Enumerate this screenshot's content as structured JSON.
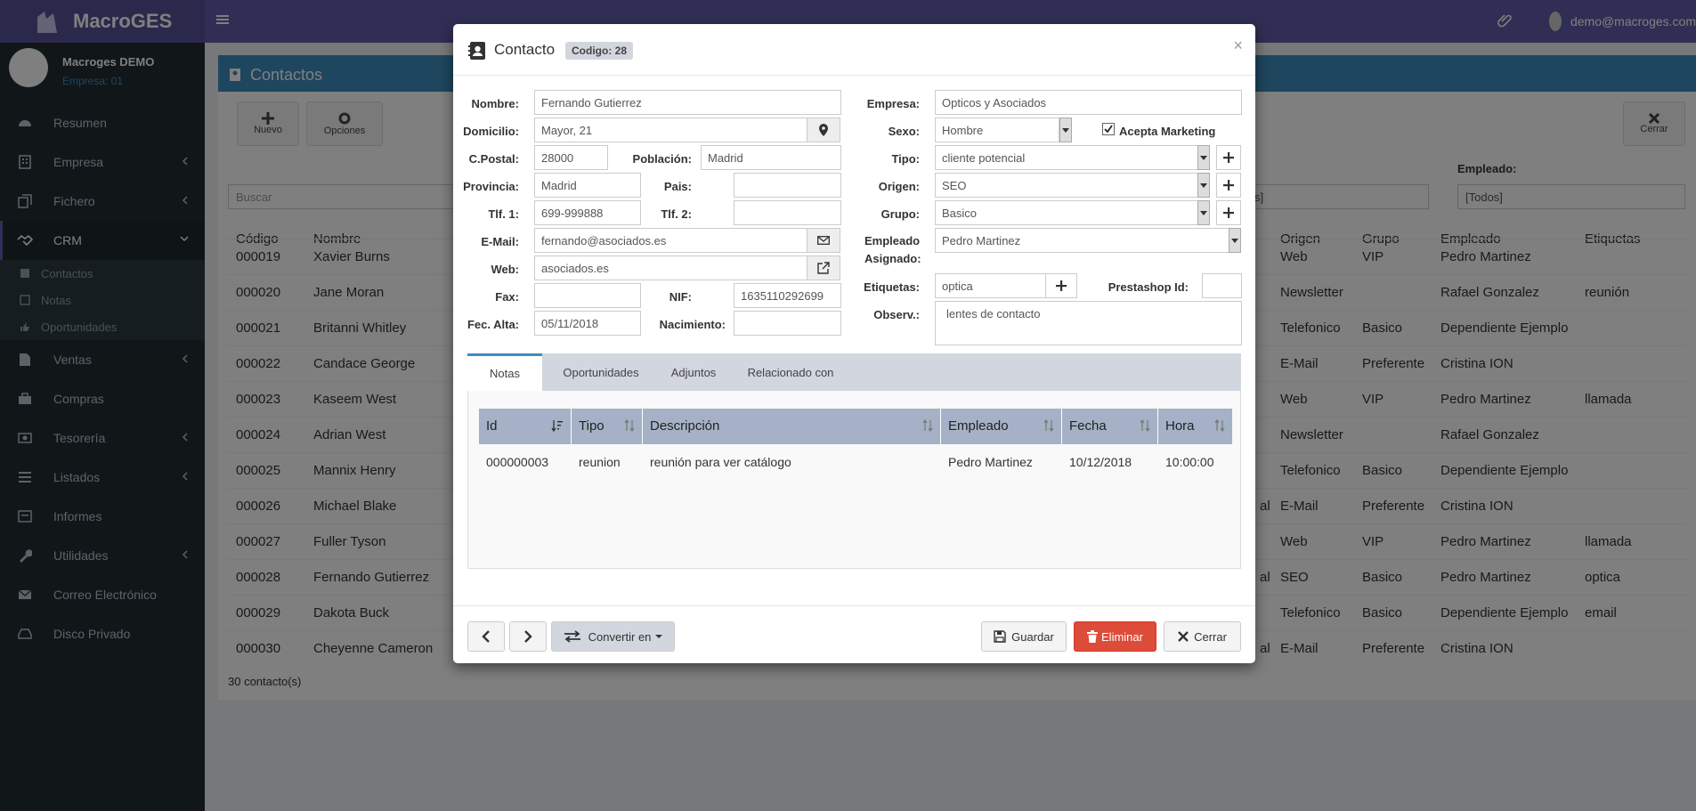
{
  "app": {
    "brand": "MacroGES",
    "user_email": "demo@macroges.com"
  },
  "sidebar": {
    "user_name": "Macroges DEMO",
    "company": "Empresa: 01",
    "items": [
      {
        "label": "Resumen"
      },
      {
        "label": "Empresa"
      },
      {
        "label": "Fichero"
      },
      {
        "label": "CRM"
      },
      {
        "label": "Ventas"
      },
      {
        "label": "Compras"
      },
      {
        "label": "Tesorería"
      },
      {
        "label": "Listados"
      },
      {
        "label": "Informes"
      },
      {
        "label": "Utilidades"
      },
      {
        "label": "Correo Electrónico"
      },
      {
        "label": "Disco Privado"
      }
    ],
    "crm_sub": [
      {
        "label": "Contactos"
      },
      {
        "label": "Notas"
      },
      {
        "label": "Oportunidades"
      }
    ]
  },
  "page": {
    "title": "Contactos",
    "nuevo": "Nuevo",
    "opciones": "Opciones",
    "cerrar": "Cerrar",
    "search_placeholder": "Buscar",
    "empleado_label": "Empleado:",
    "empleado_value": "[Todos]",
    "filter_partial": "s]",
    "count": "30 contacto(s)",
    "columns": [
      "Código",
      "Nombre",
      "Origen",
      "Grupo",
      "Empleado",
      "Etiquetas"
    ],
    "rows": [
      {
        "code": "000019",
        "name": "Xavier Burns",
        "frag": "",
        "origen": "Web",
        "grupo": "VIP",
        "empleado": "Pedro Martinez",
        "etiq": ""
      },
      {
        "code": "000020",
        "name": "Jane Moran",
        "frag": "",
        "origen": "Newsletter",
        "grupo": "",
        "empleado": "Rafael Gonzalez",
        "etiq": "reunión"
      },
      {
        "code": "000021",
        "name": "Britanni Whitley",
        "frag": "",
        "origen": "Telefonico",
        "grupo": "Basico",
        "empleado": "Dependiente Ejemplo",
        "etiq": ""
      },
      {
        "code": "000022",
        "name": "Candace George",
        "frag": "",
        "origen": "E-Mail",
        "grupo": "Preferente",
        "empleado": "Cristina ION",
        "etiq": ""
      },
      {
        "code": "000023",
        "name": "Kaseem West",
        "frag": "",
        "origen": "Web",
        "grupo": "VIP",
        "empleado": "Pedro Martinez",
        "etiq": "llamada"
      },
      {
        "code": "000024",
        "name": "Adrian West",
        "frag": "",
        "origen": "Newsletter",
        "grupo": "",
        "empleado": "Rafael Gonzalez",
        "etiq": ""
      },
      {
        "code": "000025",
        "name": "Mannix Henry",
        "frag": "",
        "origen": "Telefonico",
        "grupo": "Basico",
        "empleado": "Dependiente Ejemplo",
        "etiq": ""
      },
      {
        "code": "000026",
        "name": "Michael Blake",
        "frag": "al",
        "origen": "E-Mail",
        "grupo": "Preferente",
        "empleado": "Cristina ION",
        "etiq": ""
      },
      {
        "code": "000027",
        "name": "Fuller Tyson",
        "frag": "",
        "origen": "Web",
        "grupo": "VIP",
        "empleado": "Pedro Martinez",
        "etiq": "llamada"
      },
      {
        "code": "000028",
        "name": "Fernando Gutierrez",
        "frag": "al",
        "origen": "SEO",
        "grupo": "Basico",
        "empleado": "Pedro Martinez",
        "etiq": "optica"
      },
      {
        "code": "000029",
        "name": "Dakota Buck",
        "frag": "",
        "origen": "Telefonico",
        "grupo": "Basico",
        "empleado": "Dependiente Ejemplo",
        "etiq": "email"
      },
      {
        "code": "000030",
        "name": "Cheyenne Cameron",
        "frag": "al",
        "origen": "E-Mail",
        "grupo": "Preferente",
        "empleado": "Cristina ION",
        "etiq": ""
      }
    ]
  },
  "modal": {
    "title": "Contacto",
    "badge": "Codigo: 28",
    "close": "×",
    "labels": {
      "nombre": "Nombre:",
      "domicilio": "Domicilio:",
      "cpostal": "C.Postal:",
      "poblacion": "Población:",
      "provincia": "Provincia:",
      "pais": "Pais:",
      "tlf1": "Tlf. 1:",
      "tlf2": "Tlf. 2:",
      "email": "E-Mail:",
      "web": "Web:",
      "fax": "Fax:",
      "nif": "NIF:",
      "fecalta": "Fec. Alta:",
      "nacimiento": "Nacimiento:",
      "empresa": "Empresa:",
      "sexo": "Sexo:",
      "acepta": "Acepta Marketing",
      "tipo": "Tipo:",
      "origen": "Origen:",
      "grupo": "Grupo:",
      "empleado1": "Empleado",
      "empleado2": "Asignado:",
      "etiquetas": "Etiquetas:",
      "prestashop": "Prestashop Id:",
      "observ": "Observ.:"
    },
    "values": {
      "nombre": "Fernando Gutierrez",
      "domicilio": "Mayor, 21",
      "cpostal": "28000",
      "poblacion": "Madrid",
      "provincia": "Madrid",
      "pais": "",
      "tlf1": "699-999888",
      "tlf2": "",
      "email": "fernando@asociados.es",
      "web": "asociados.es",
      "fax": "",
      "nif": "1635110292699",
      "fecalta": "05/11/2018",
      "nacimiento": "",
      "empresa": "Opticos y Asociados",
      "sexo": "Hombre",
      "tipo": "cliente potencial",
      "origen": "SEO",
      "grupo": "Basico",
      "empleado": "Pedro Martinez",
      "etiquetas": "optica",
      "prestashop": "",
      "observ": "lentes de contacto"
    },
    "tabs": [
      "Notas",
      "Oportunidades",
      "Adjuntos",
      "Relacionado con"
    ],
    "notes_cols": [
      "Id",
      "Tipo",
      "Descripción",
      "Empleado",
      "Fecha",
      "Hora"
    ],
    "notes_row": [
      "000000003",
      "reunion",
      "reunión para ver catálogo",
      "Pedro Martinez",
      "10/12/2018",
      "10:00:00"
    ],
    "buttons": {
      "convert": "Convertir en",
      "save": "Guardar",
      "delete": "Eliminar",
      "close": "Cerrar"
    }
  },
  "colors": {
    "topbar": "#605ca8",
    "sidebar": "#222d32",
    "accent": "#3c8dbc",
    "danger": "#dd4b39"
  }
}
